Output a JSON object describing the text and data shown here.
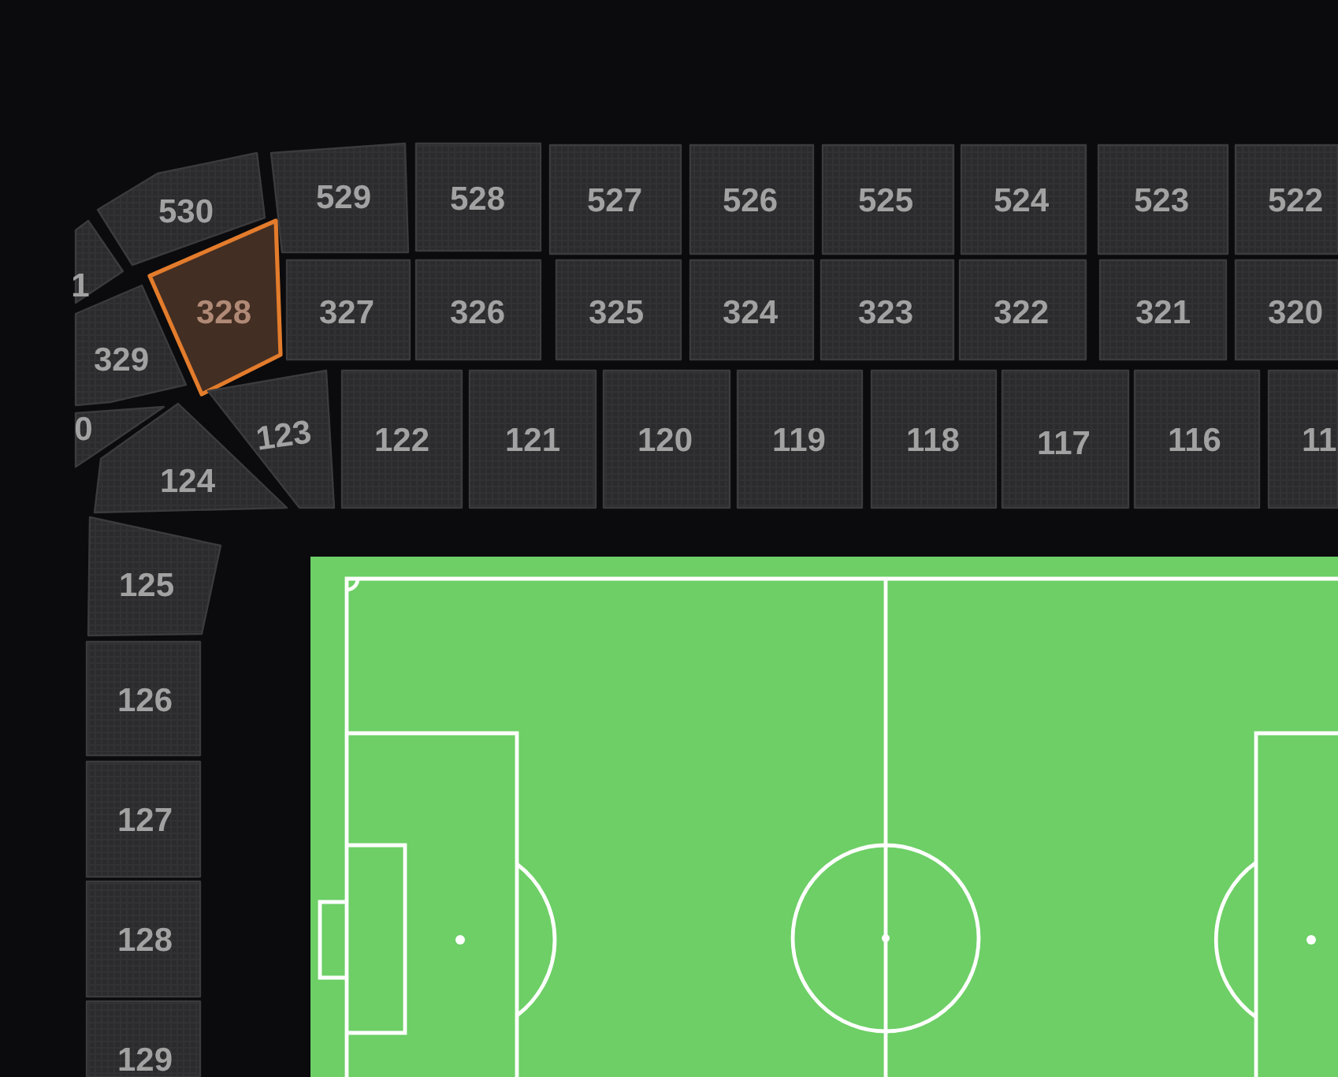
{
  "seat_map": {
    "upper_ring": [
      {
        "label": "530",
        "selected": false
      },
      {
        "label": "529",
        "selected": false
      },
      {
        "label": "528",
        "selected": false
      },
      {
        "label": "527",
        "selected": false
      },
      {
        "label": "526",
        "selected": false
      },
      {
        "label": "525",
        "selected": false
      },
      {
        "label": "524",
        "selected": false
      },
      {
        "label": "523",
        "selected": false
      },
      {
        "label": "522",
        "selected": false
      }
    ],
    "middle_ring": [
      {
        "label": "1",
        "selected": false
      },
      {
        "label": "329",
        "selected": false
      },
      {
        "label": "328",
        "selected": true
      },
      {
        "label": "327",
        "selected": false
      },
      {
        "label": "326",
        "selected": false
      },
      {
        "label": "325",
        "selected": false
      },
      {
        "label": "324",
        "selected": false
      },
      {
        "label": "323",
        "selected": false
      },
      {
        "label": "322",
        "selected": false
      },
      {
        "label": "321",
        "selected": false
      },
      {
        "label": "320",
        "selected": false
      }
    ],
    "lower_ring": [
      {
        "label": "0",
        "selected": false
      },
      {
        "label": "124",
        "selected": false
      },
      {
        "label": "123",
        "selected": false
      },
      {
        "label": "122",
        "selected": false
      },
      {
        "label": "121",
        "selected": false
      },
      {
        "label": "120",
        "selected": false
      },
      {
        "label": "119",
        "selected": false
      },
      {
        "label": "118",
        "selected": false
      },
      {
        "label": "117",
        "selected": false
      },
      {
        "label": "116",
        "selected": false
      },
      {
        "label": "11",
        "selected": false
      }
    ],
    "side_column": [
      {
        "label": "125",
        "selected": false
      },
      {
        "label": "126",
        "selected": false
      },
      {
        "label": "127",
        "selected": false
      },
      {
        "label": "128",
        "selected": false
      },
      {
        "label": "129",
        "selected": false
      }
    ]
  }
}
